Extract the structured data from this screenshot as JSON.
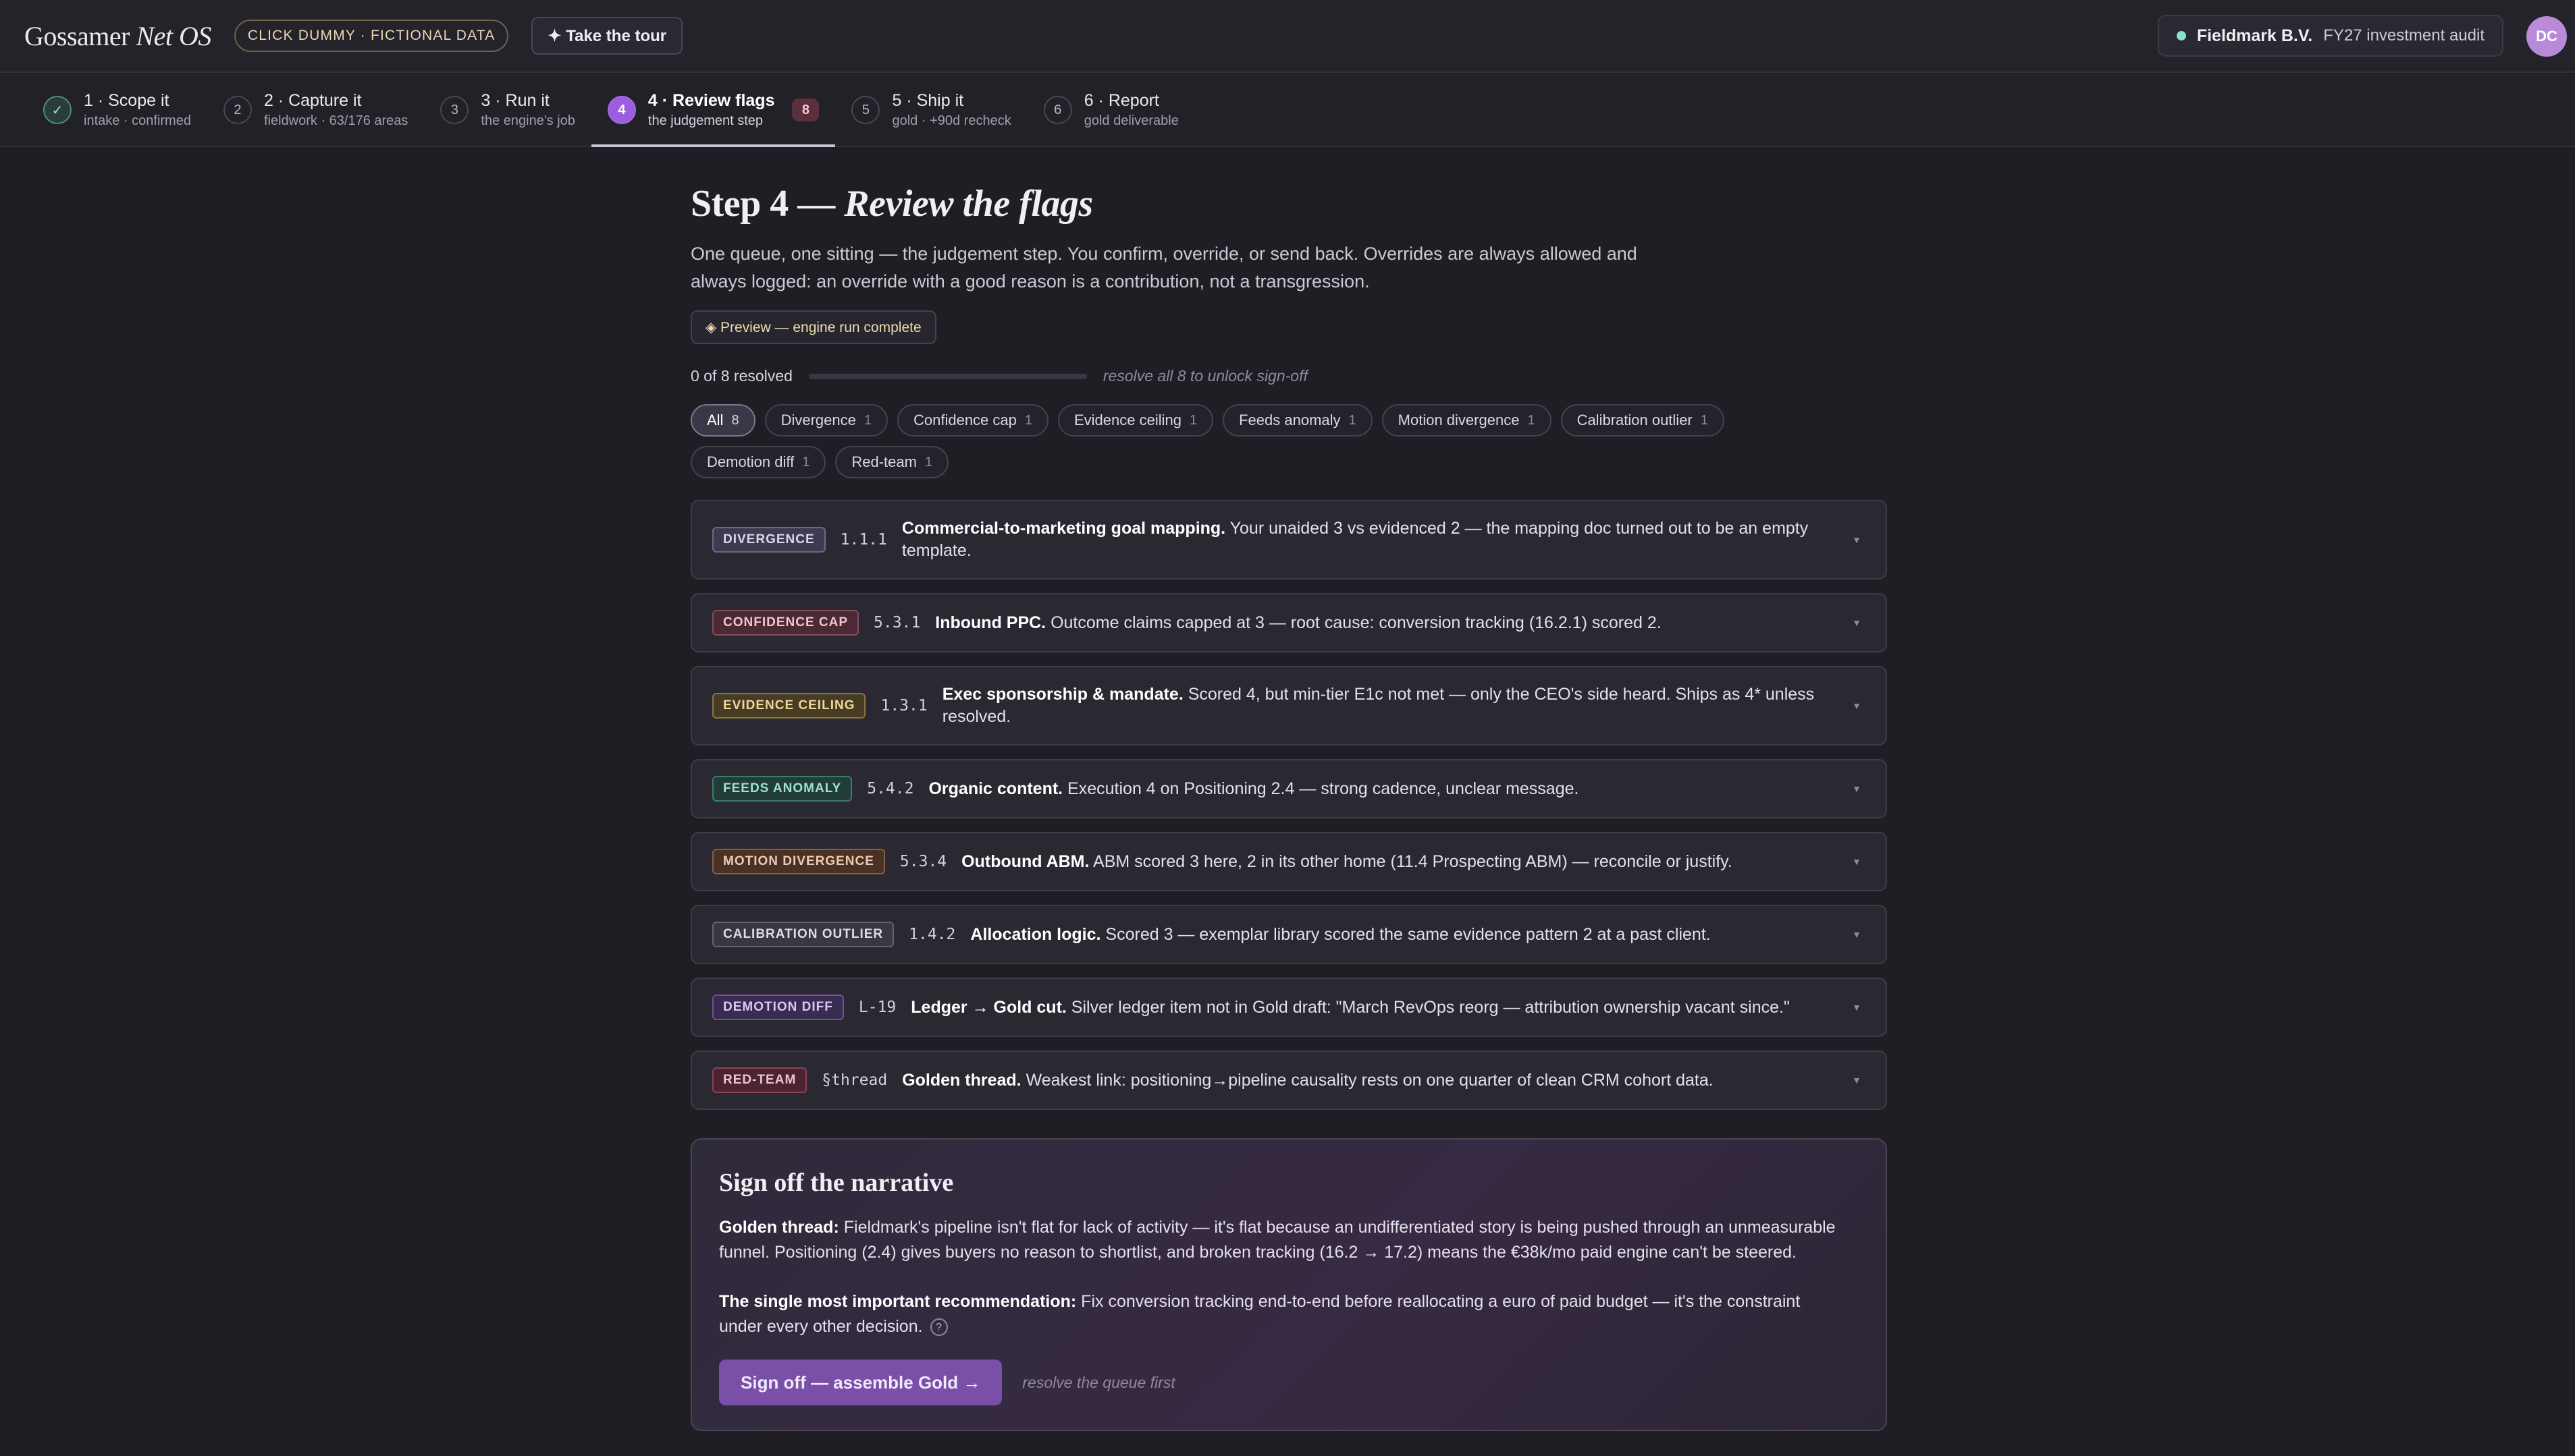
{
  "brand": {
    "name": "Gossamer",
    "suffix": "Net OS"
  },
  "badge": "CLICK DUMMY · FICTIONAL DATA",
  "tour_label": "✦ Take the tour",
  "client": {
    "name": "Fieldmark B.V.",
    "engagement": "FY27 investment audit",
    "status_color": "#8ee0c8"
  },
  "user": {
    "initials": "DC"
  },
  "steps": [
    {
      "num": "✓",
      "title": "1 · Scope it",
      "sub": "intake · confirmed",
      "state": "done"
    },
    {
      "num": "2",
      "title": "2 · Capture it",
      "sub": "fieldwork · 63/176 areas",
      "state": "todo"
    },
    {
      "num": "3",
      "title": "3 · Run it",
      "sub": "the engine's job",
      "state": "todo"
    },
    {
      "num": "4",
      "title": "4 · Review flags",
      "sub": "the judgement step",
      "state": "active",
      "count": "8"
    },
    {
      "num": "5",
      "title": "5 · Ship it",
      "sub": "gold · +90d recheck",
      "state": "todo"
    },
    {
      "num": "6",
      "title": "6 · Report",
      "sub": "gold deliverable",
      "state": "todo"
    }
  ],
  "page": {
    "title_plain": "Step 4 — ",
    "title_italic": "Review the flags",
    "lede": "One queue, one sitting — the judgement step. You confirm, override, or send back. Overrides are always allowed and always logged: an override with a good reason is a contribution, not a transgression.",
    "preview": "◈ Preview — engine run complete"
  },
  "progress": {
    "label": "0 of 8 resolved",
    "resolved": 0,
    "total": 8,
    "hint": "resolve all 8 to unlock sign-off"
  },
  "filters": [
    {
      "label": "All",
      "count": "8",
      "active": true
    },
    {
      "label": "Divergence",
      "count": "1"
    },
    {
      "label": "Confidence cap",
      "count": "1"
    },
    {
      "label": "Evidence ceiling",
      "count": "1"
    },
    {
      "label": "Feeds anomaly",
      "count": "1"
    },
    {
      "label": "Motion divergence",
      "count": "1"
    },
    {
      "label": "Calibration outlier",
      "count": "1"
    },
    {
      "label": "Demotion diff",
      "count": "1"
    },
    {
      "label": "Red-team",
      "count": "1"
    }
  ],
  "flags": [
    {
      "tag": "DIVERGENCE",
      "ref": "1.1.1",
      "title": "Commercial-to-marketing goal mapping.",
      "text": " Your unaided 3 vs evidenced 2 — the mapping doc turned out to be an empty template."
    },
    {
      "tag": "CONFIDENCE CAP",
      "ref": "5.3.1",
      "title": "Inbound PPC.",
      "text": " Outcome claims capped at 3 — root cause: conversion tracking (16.2.1) scored 2."
    },
    {
      "tag": "EVIDENCE CEILING",
      "ref": "1.3.1",
      "title": "Exec sponsorship & mandate.",
      "text": " Scored 4, but min-tier E1c not met — only the CEO's side heard. Ships as 4* unless resolved."
    },
    {
      "tag": "FEEDS ANOMALY",
      "ref": "5.4.2",
      "title": "Organic content.",
      "text": " Execution 4 on Positioning 2.4 — strong cadence, unclear message."
    },
    {
      "tag": "MOTION DIVERGENCE",
      "ref": "5.3.4",
      "title": "Outbound ABM.",
      "text": " ABM scored 3 here, 2 in its other home (11.4 Prospecting ABM) — reconcile or justify."
    },
    {
      "tag": "CALIBRATION OUTLIER",
      "ref": "1.4.2",
      "title": "Allocation logic.",
      "text": " Scored 3 — exemplar library scored the same evidence pattern 2 at a past client."
    },
    {
      "tag": "DEMOTION DIFF",
      "ref": "L-19",
      "title": "Ledger → Gold cut.",
      "text": " Silver ledger item not in Gold draft: \"March RevOps reorg — attribution ownership vacant since.\""
    },
    {
      "tag": "RED-TEAM",
      "ref": "§thread",
      "title": "Golden thread.",
      "text": " Weakest link: positioning→pipeline causality rests on one quarter of clean CRM cohort data."
    }
  ],
  "signoff": {
    "title": "Sign off the narrative",
    "golden_label": "Golden thread:",
    "golden_text": " Fieldmark's pipeline isn't flat for lack of activity — it's flat because an undifferentiated story is being pushed through an unmeasurable funnel. Positioning (2.4) gives buyers no reason to shortlist, and broken tracking (16.2 → 17.2) means the €38k/mo paid engine can't be steered.",
    "rec_label": "The single most important recommendation:",
    "rec_text": " Fix conversion tracking end-to-end before reallocating a euro of paid budget — it's the constraint under every other decision.",
    "help_glyph": "?",
    "cta": "Sign off — assemble Gold →",
    "hint": "resolve the queue first"
  },
  "icons": {
    "done": "check-icon",
    "chevron": "chevron-down-icon",
    "help": "help-circle-icon"
  },
  "colors": {
    "accent": "#9b5ee0",
    "background": "#201e25",
    "cta": "#7a4fa8"
  }
}
